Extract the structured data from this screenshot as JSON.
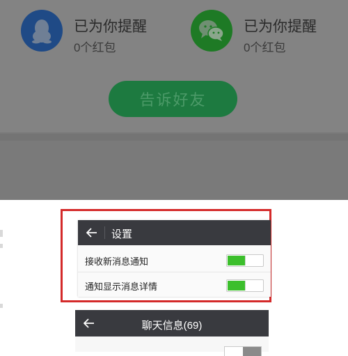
{
  "redpacket": {
    "items": [
      {
        "id": "qq",
        "title": "已为你提醒",
        "subtitle": "0个红包",
        "icon": "qq-penguin-icon",
        "color": "#1f4a86"
      },
      {
        "id": "wechat",
        "title": "已为你提醒",
        "subtitle": "0个红包",
        "icon": "wechat-icon",
        "color": "#1e7a25"
      }
    ],
    "tell_button": "告诉好友",
    "button_color": "#1d7a40"
  },
  "settings": {
    "title": "设置",
    "rows": [
      {
        "label": "接收新消息通知",
        "enabled": true
      },
      {
        "label": "通知显示消息详情",
        "enabled": true
      }
    ],
    "toggle_on_color": "#3cbf2c",
    "highlight_color": "#d42a2a"
  },
  "chat_info": {
    "title": "聊天信息(69)"
  }
}
